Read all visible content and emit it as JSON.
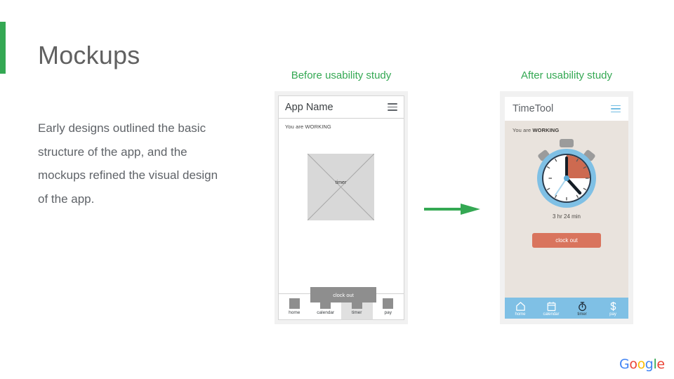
{
  "slide": {
    "title": "Mockups",
    "body": "Early designs outlined the basic structure of the app, and the mockups refined the visual design of the app.",
    "accent_color": "#34a853"
  },
  "captions": {
    "before": "Before usability study",
    "after": "After usability study",
    "color": "#34a853"
  },
  "arrow": {
    "icon": "right-arrow-icon",
    "color": "#34a853"
  },
  "before_mockup": {
    "app_title": "App Name",
    "menu_icon": "hamburger-menu-icon",
    "status_text": "You are WORKING",
    "placeholder_label": "timer",
    "placeholder_icon": "image-placeholder-icon",
    "clock_out_label": "clock out",
    "clock_out_color": "#8e8e8e",
    "nav": [
      {
        "label": "home",
        "icon": "home-icon",
        "active": false
      },
      {
        "label": "calendar",
        "icon": "calendar-icon",
        "active": false
      },
      {
        "label": "timer",
        "icon": "timer-icon",
        "active": true
      },
      {
        "label": "pay",
        "icon": "pay-icon",
        "active": false
      }
    ]
  },
  "after_mockup": {
    "app_title": "TimeTool",
    "menu_icon": "hamburger-menu-icon",
    "menu_color": "#72bde3",
    "status_prefix": "You are ",
    "status_state": "WORKING",
    "stopwatch_icon": "stopwatch-icon",
    "elapsed_time": "3 hr 24 min",
    "clock_out_label": "clock out",
    "clock_out_color": "#d9745d",
    "nav_bar_color": "#7fc0e5",
    "nav": [
      {
        "label": "home",
        "icon": "home-icon",
        "active": false
      },
      {
        "label": "calendar",
        "icon": "calendar-icon",
        "active": false
      },
      {
        "label": "timer",
        "icon": "stopwatch-icon",
        "active": true
      },
      {
        "label": "pay",
        "icon": "dollar-sign-icon",
        "active": false
      }
    ]
  },
  "footer": {
    "logo_letters": [
      "G",
      "o",
      "o",
      "g",
      "l",
      "e"
    ],
    "logo_colors": [
      "#4285f4",
      "#ea4335",
      "#fbbc05",
      "#4285f4",
      "#34a853",
      "#ea4335"
    ]
  }
}
